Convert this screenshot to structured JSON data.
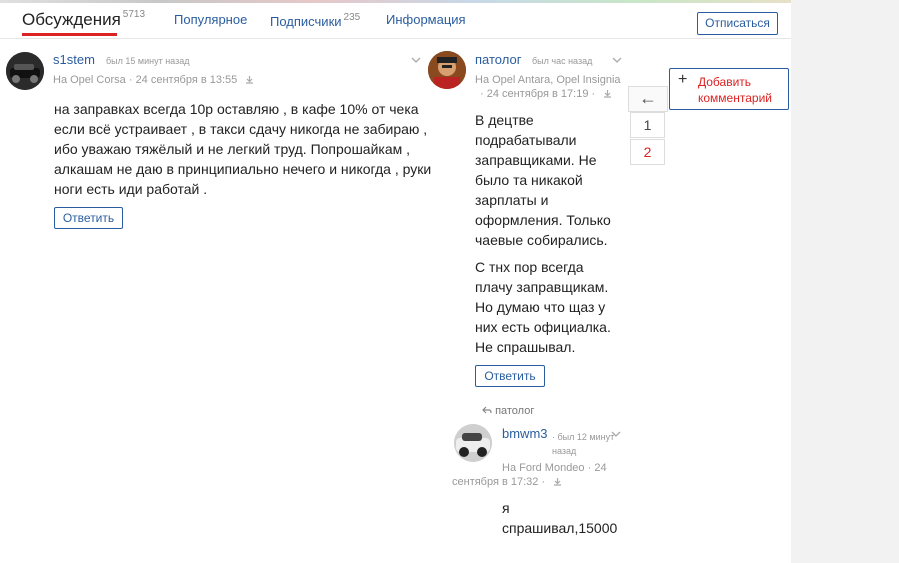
{
  "tabs": [
    {
      "label": "Обсуждения",
      "count": "5713"
    },
    {
      "label": "Популярное",
      "count": ""
    },
    {
      "label": "Подписчики",
      "count": "235"
    },
    {
      "label": "Информация",
      "count": ""
    }
  ],
  "unsubscribe_label": "Отписаться",
  "comments": [
    {
      "user": "s1stem",
      "seen": "был 15 минут назад",
      "car": "На Opel Corsa",
      "date": "24 сентября в 13:55",
      "text": "на заправках всегда 10р оставляю , в кафе 10% от чека если всё устраивает , в такси сдачу никогда не забираю , ибо уважаю тяжёлый и не легкий труд. Попрошайкам , алкашам не даю в принципиально нечего и никогда , руки ноги есть иди работай .",
      "reply_label": "Ответить"
    },
    {
      "user": "патолог",
      "seen": "был час назад",
      "car": "На Opel Antara, Opel Insignia",
      "date": "24 сентября в 17:19",
      "text1": "В децтве подрабатывали заправщиками. Не было та никакой зарплаты и оформления. Только чаевые собирались.",
      "text2": "С тнх пор всегда плачу заправщикам. Но думаю что щаз у них есть официалка. Не спрашывал.",
      "reply_label": "Ответить"
    },
    {
      "reply_to": "патолог",
      "user": "bmwm3",
      "seen": "был 12 минут назад",
      "car": "На Ford Mondeo",
      "date_part1": "24",
      "date_part2": "сентября в 17:32",
      "text_line1": "я",
      "text_line2": "спрашивал,15000"
    }
  ],
  "pager": {
    "back": "←",
    "pages": [
      "1",
      "2"
    ],
    "current": "2"
  },
  "add_comment_label": "Добавить комментарий",
  "colors": {
    "link": "#2a5d9f",
    "accent": "#d22",
    "muted": "#999"
  }
}
